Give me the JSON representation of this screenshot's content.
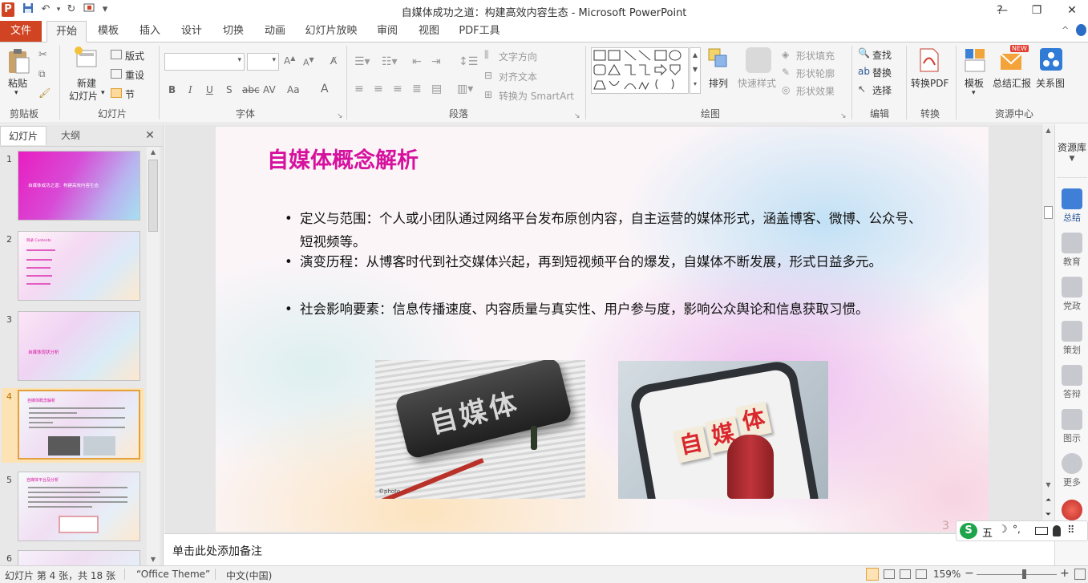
{
  "window": {
    "title": "自媒体成功之道：构建高效内容生态  -  Microsoft PowerPoint",
    "minimize": "—",
    "restore": "❐",
    "close": "✕",
    "help": "?",
    "collapse": "^"
  },
  "quick_access": {
    "app_icon": "P",
    "save": "💾",
    "undo": "↶",
    "redo": "↻",
    "customize": "▾"
  },
  "tabs": [
    "文件",
    "开始",
    "模板",
    "插入",
    "设计",
    "切换",
    "动画",
    "幻灯片放映",
    "审阅",
    "视图",
    "PDF工具"
  ],
  "ribbon": {
    "clipboard": {
      "label": "剪贴板",
      "paste": "粘贴"
    },
    "slides": {
      "label": "幻灯片",
      "new_slide": "新建",
      "new_slide2": "幻灯片",
      "layout": "版式",
      "reset": "重设",
      "section": "节"
    },
    "font": {
      "label": "字体",
      "b": "B",
      "i": "I",
      "u": "U",
      "s": "S",
      "abc": "abc",
      "av": "AV",
      "aa": "Aa",
      "a": "A"
    },
    "paragraph": {
      "label": "段落",
      "text_direction": "文字方向",
      "align_text": "对齐文本",
      "smartart": "转换为 SmartArt"
    },
    "drawing": {
      "label": "绘图",
      "arrange": "排列",
      "quick_styles": "快速样式",
      "shape_fill": "形状填充",
      "shape_outline": "形状轮廓",
      "shape_effects": "形状效果"
    },
    "editing": {
      "label": "编辑",
      "find": "查找",
      "replace": "替换",
      "select": "选择"
    },
    "convert": {
      "label": "转换",
      "to_pdf": "转换PDF"
    },
    "resources": {
      "label": "资源中心",
      "template": "模板",
      "summary": "总结汇报",
      "relation": "关系图",
      "new_badge": "NEW"
    }
  },
  "panel_tabs": {
    "slides": "幻灯片",
    "outline": "大纲",
    "close": "✕"
  },
  "thumbnails": [
    {
      "num": "1",
      "text": "自媒体成功之道：构建高效内容生态"
    },
    {
      "num": "2",
      "text": "目录 Contents"
    },
    {
      "num": "3",
      "text": "自媒体现状分析"
    },
    {
      "num": "4",
      "text": "自媒体概念解析"
    },
    {
      "num": "5",
      "text": "自媒体平台及分析"
    },
    {
      "num": "6",
      "text": ""
    }
  ],
  "slide": {
    "title": "自媒体概念解析",
    "bullets": [
      "定义与范围：个人或小团队通过网络平台发布原创内容，自主运营的媒体形式，涵盖博客、微博、公众号、短视频等。",
      "演变历程：从博客时代到社交媒体兴起，再到短视频平台的爆发，自媒体不断发展，形式日益多元。",
      "社会影响要素：信息传播速度、内容质量与真实性、用户参与度，影响公众舆论和信息获取习惯。"
    ],
    "img1_text": "自媒体",
    "img1_credit": "©photo",
    "img2_text": [
      "自",
      "媒",
      "体"
    ],
    "page_num": "3"
  },
  "right_pane": {
    "header": "资源库",
    "items": [
      "总结",
      "教育",
      "党政",
      "策划",
      "答辩",
      "图示",
      "更多"
    ]
  },
  "notes": {
    "placeholder": "单击此处添加备注"
  },
  "ime": {
    "logo": "S",
    "mode": "五",
    "moon": "☽",
    "punct": "°,"
  },
  "status": {
    "slide_info": "幻灯片 第 4 张，共 18 张",
    "theme": "“Office Theme”",
    "lang": "中文(中国)",
    "zoom": "159%",
    "zoom_minus": "−",
    "zoom_plus": "+"
  }
}
